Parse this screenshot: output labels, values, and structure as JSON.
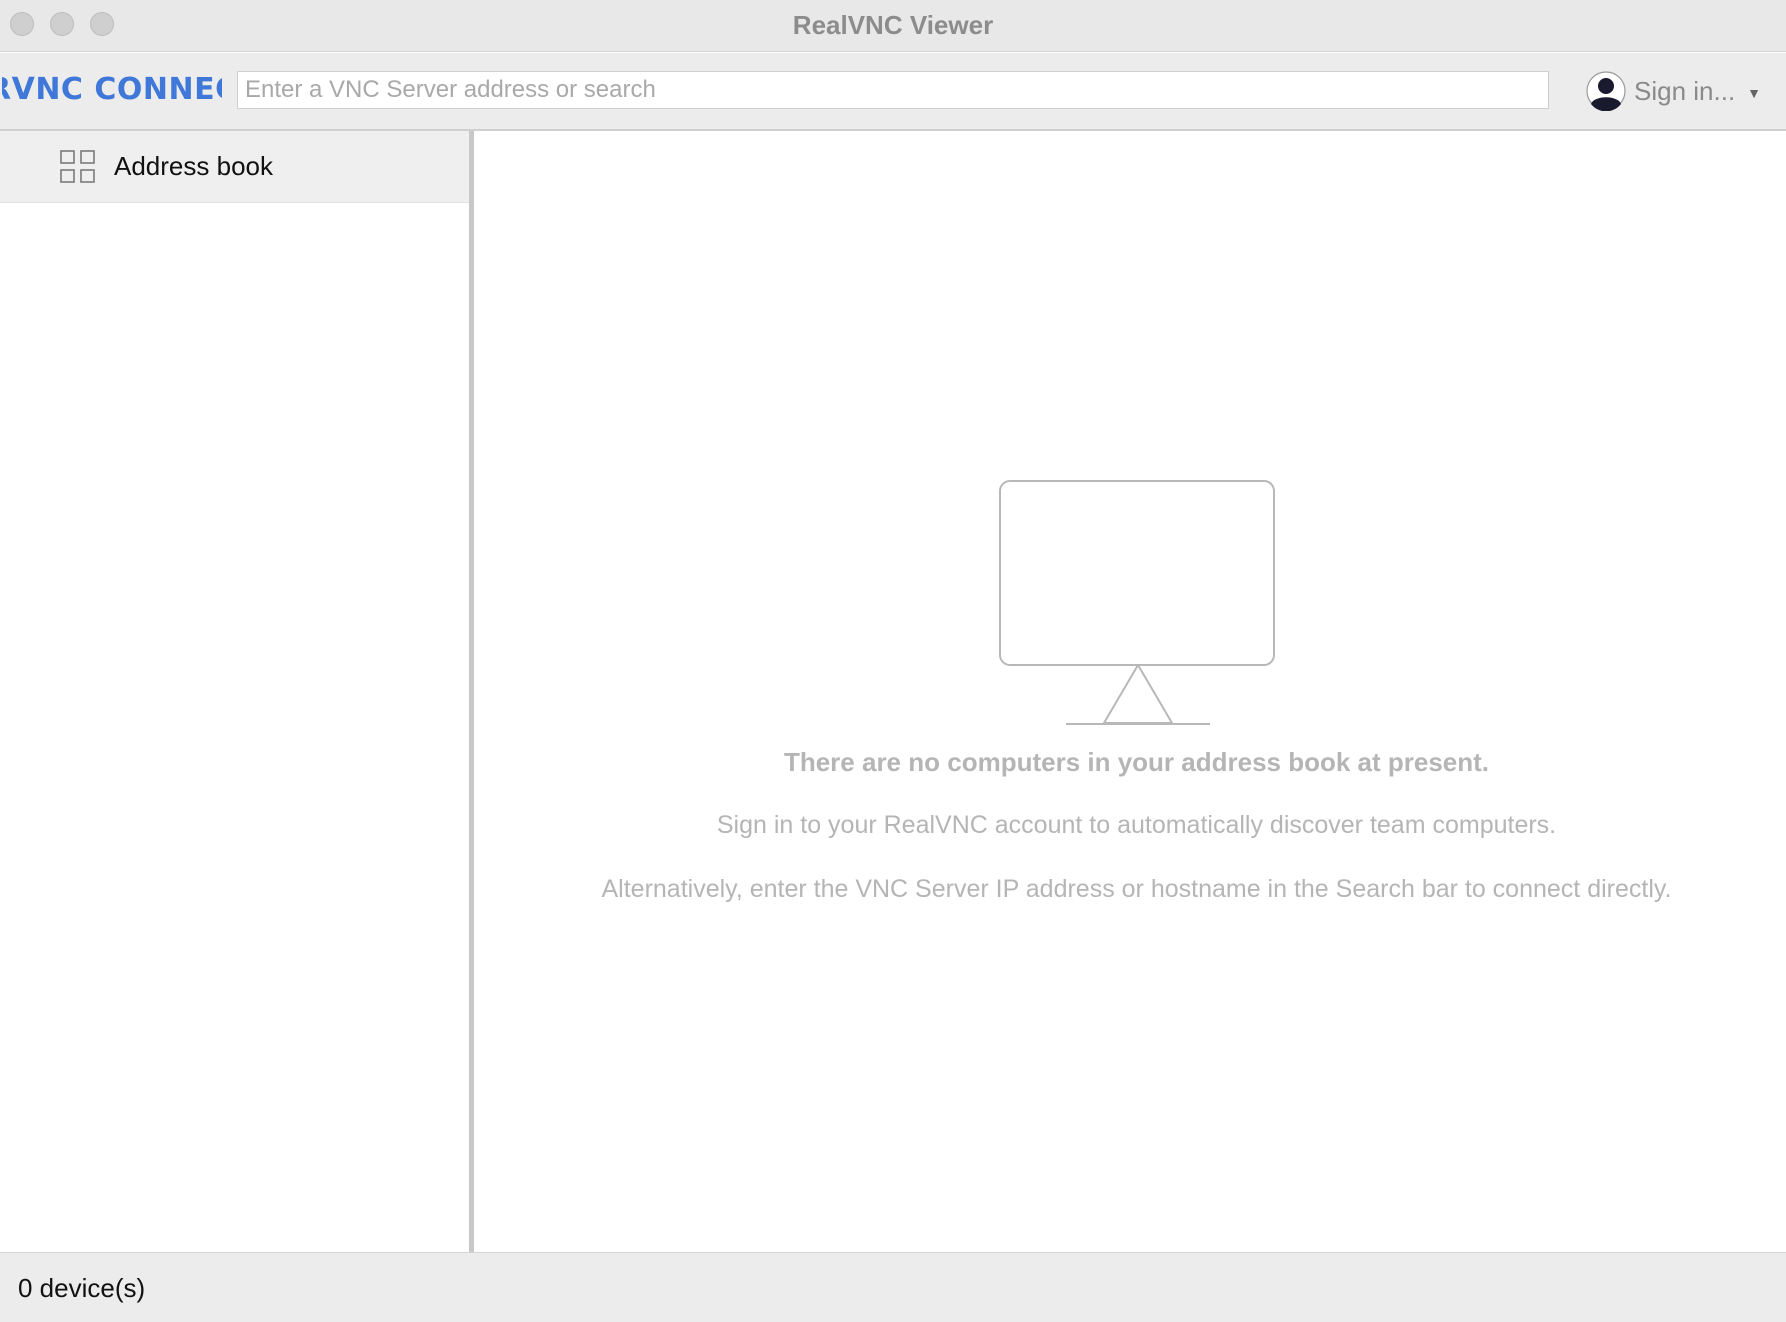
{
  "window": {
    "title": "RealVNC Viewer"
  },
  "toolbar": {
    "logo_text": "RVNC CONNECT",
    "search": {
      "placeholder": "Enter a VNC Server address or search",
      "value": ""
    },
    "signin": {
      "label": "Sign in...",
      "icon": "user-avatar-icon"
    }
  },
  "sidebar": {
    "items": [
      {
        "label": "Address book",
        "icon": "grid-icon",
        "selected": true
      }
    ]
  },
  "main": {
    "empty_state": {
      "icon": "monitor-icon",
      "title": "There are no computers in your address book at present.",
      "line1": "Sign in to your RealVNC account to automatically discover team computers.",
      "line2": "Alternatively, enter the VNC Server IP address or hostname in the Search bar to connect directly."
    }
  },
  "statusbar": {
    "device_count": "0 device(s)"
  },
  "colors": {
    "accent": "#3f78d9",
    "muted_text": "#b5b5b5"
  }
}
